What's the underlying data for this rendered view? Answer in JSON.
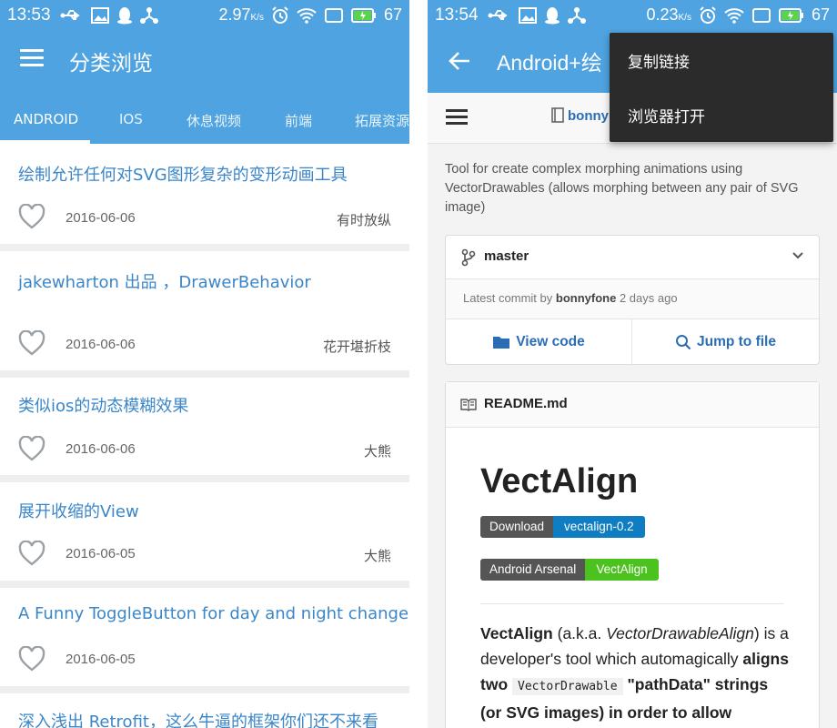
{
  "left": {
    "status": {
      "time": "13:53",
      "speed": "2.97",
      "speed_unit": "K/s",
      "battery": "67"
    },
    "appbar": {
      "title": "分类浏览"
    },
    "tabs": [
      "ANDROID",
      "IOS",
      "休息视频",
      "前端",
      "拓展资源"
    ],
    "active_tab": 0,
    "items": [
      {
        "title": "绘制允许任何对SVG图形复杂的变形动画工具",
        "date": "2016-06-06",
        "author": "有时放纵"
      },
      {
        "title": "jakewharton 出品 ，DrawerBehavior",
        "date": "2016-06-06",
        "author": "花开堪折枝"
      },
      {
        "title": "类似ios的动态模糊效果",
        "date": "2016-06-06",
        "author": "大熊"
      },
      {
        "title": "展开收缩的View",
        "date": "2016-06-05",
        "author": "大熊"
      },
      {
        "title": "A Funny ToggleButton for day and night change",
        "date": "2016-06-05",
        "author": ""
      },
      {
        "title": "深入浅出 Retrofit，这么牛逼的框架你们还不来看",
        "date": "",
        "author": ""
      }
    ]
  },
  "right": {
    "status": {
      "time": "13:54",
      "speed": "0.23",
      "speed_unit": "K/s",
      "battery": "67"
    },
    "appbar": {
      "title": "Android+绘"
    },
    "repo": {
      "owner": "bonny"
    },
    "popup": {
      "items": [
        "复制链接",
        "浏览器打开"
      ]
    },
    "description": "Tool for create complex morphing animations using VectorDrawables (allows morphing between any pair of SVG image)",
    "branch": "master",
    "commit": {
      "prefix": "Latest commit by",
      "author": "bonnyfone",
      "when": "2 days ago"
    },
    "buttons": {
      "view_code": "View code",
      "jump_to_file": "Jump to file"
    },
    "readme": {
      "filename": "README.md",
      "heading": "VectAlign",
      "badge1": {
        "left": "Download",
        "right": "vectalign-0.2",
        "color": "#0f7dc2"
      },
      "badge2": {
        "left": "Android Arsenal",
        "right": "VectAlign",
        "color": "#4cc21f"
      },
      "para": {
        "t1": "VectAlign",
        "t2": " (a.k.a. ",
        "t3": "VectorDrawableAlign",
        "t4": ") is a developer's tool which automagically ",
        "t5": "aligns two",
        "t6": "VectorDrawable",
        "t7": "\"pathData\" strings (or SVG images) in order to allow"
      }
    }
  },
  "colors": {
    "primary": "#4fa3e0",
    "link": "#3a86c8",
    "github_link": "#2a6db5"
  }
}
